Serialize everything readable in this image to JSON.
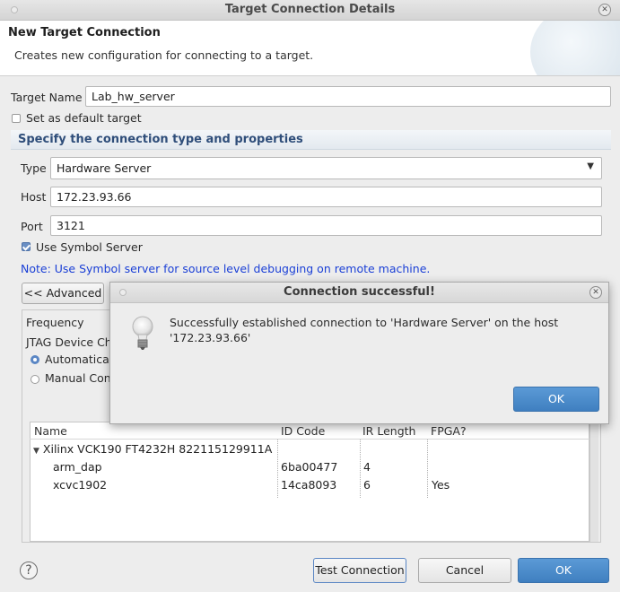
{
  "window": {
    "title": "Target Connection Details"
  },
  "header": {
    "title": "New Target Connection",
    "subtitle": "Creates new configuration for connecting to a target."
  },
  "form": {
    "target_name_label": "Target Name",
    "target_name_value": "Lab_hw_server",
    "default_target_label": "Set as default target",
    "section_title": "Specify the connection type and properties",
    "type_label": "Type",
    "type_value": "Hardware Server",
    "host_label": "Host",
    "host_value": "172.23.93.66",
    "port_label": "Port",
    "port_value": "3121",
    "symbol_server_label": "Use Symbol Server",
    "note": "Note: Use Symbol server for source level debugging on remote machine.",
    "advanced_button": "<< Advanced"
  },
  "advanced": {
    "frequency_label": "Frequency",
    "jtag_label": "JTAG Device Ch",
    "radio_auto": "Automatical",
    "radio_manual": "Manual Con"
  },
  "table": {
    "columns": [
      "Name",
      "ID Code",
      "IR Length",
      "FPGA?"
    ],
    "group": "Xilinx VCK190 FT4232H 822115129911A",
    "rows": [
      {
        "name": "arm_dap",
        "id": "6ba00477",
        "ir": "4",
        "fpga": ""
      },
      {
        "name": "xcvc1902",
        "id": "14ca8093",
        "ir": "6",
        "fpga": "Yes"
      }
    ]
  },
  "footer": {
    "help": "?",
    "test_button": "Test Connection",
    "cancel_button": "Cancel",
    "ok_button": "OK"
  },
  "popup": {
    "title": "Connection successful!",
    "message_line1": "Successfully established connection to 'Hardware Server' on the host",
    "message_line2": "'172.23.93.66'",
    "ok_button": "OK",
    "icon": "lightbulb-icon"
  },
  "colors": {
    "accent": "#4a88c9",
    "note_text": "#1a3fd6",
    "section_text": "#2f4e7a"
  }
}
